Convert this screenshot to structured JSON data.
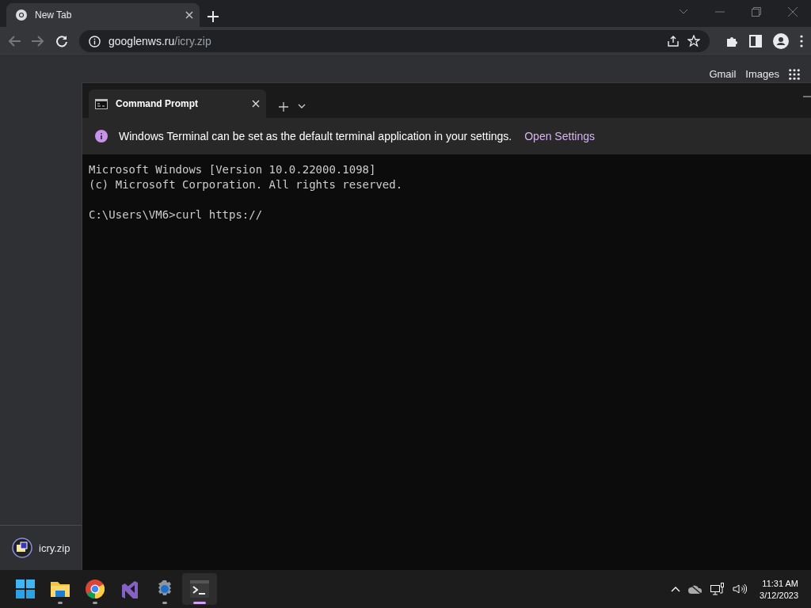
{
  "browser": {
    "tabs": [
      {
        "title": "New Tab",
        "selected": true
      }
    ],
    "url": "**googlenws.ru**/icry.zip",
    "page_links": [
      "Gmail",
      "Images"
    ],
    "downloads": [
      {
        "name": "icry.zip"
      }
    ]
  },
  "terminal": {
    "tabs": [
      {
        "title": "Command Prompt",
        "selected": true
      }
    ],
    "infobar": {
      "message": "Windows Terminal can be set as the default terminal application in your settings.",
      "link": "Open Settings"
    },
    "blocks": [
      [
        "Microsoft Windows [Version 10.0.22000.1098]",
        "(c) Microsoft Corporation. All rights reserved."
      ],
      [
        "C:\\Users\\VM6>curl https://"
      ]
    ]
  },
  "taskbar": {
    "apps": [
      {
        "kind": "start",
        "running": false,
        "selected": false
      },
      {
        "kind": "folder",
        "running": true,
        "selected": false
      },
      {
        "kind": "browser",
        "running": true,
        "selected": false
      },
      {
        "kind": "ide",
        "running": false,
        "selected": false
      },
      {
        "kind": "settings",
        "running": true,
        "selected": false
      },
      {
        "kind": "terminal",
        "running": true,
        "selected": true
      }
    ],
    "time": "11:31 AM",
    "date": "3/12/2023"
  }
}
